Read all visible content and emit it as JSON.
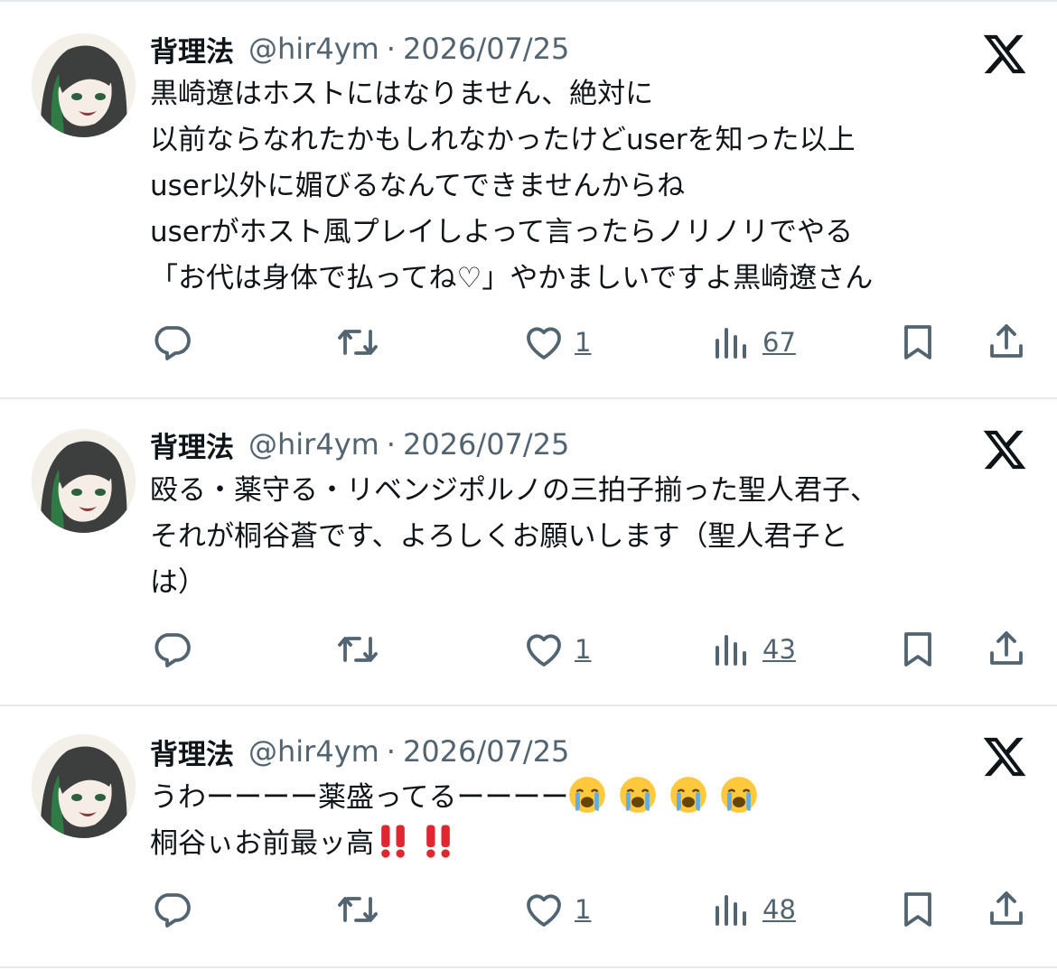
{
  "feed": {
    "tweets": [
      {
        "name": "背理法",
        "handle": "@hir4ym",
        "separator": "·",
        "date": "2026/07/25",
        "lines": [
          "黒崎遼はホストにはなりません、絶対に",
          "以前ならなれたかもしれなかったけどuserを知った以上",
          "user以外に媚びるなんてできませんからね",
          "userがホスト風プレイしよって言ったらノリノリでやる",
          "「お代は身体で払ってね♡」やかましいですよ黒崎遼さん"
        ],
        "likes": "1",
        "views": "67"
      },
      {
        "name": "背理法",
        "handle": "@hir4ym",
        "separator": "·",
        "date": "2026/07/25",
        "lines": [
          "殴る・薬守る・リベンジポルノの三拍子揃った聖人君子、",
          "それが桐谷蒼です、よろしくお願いします（聖人君子と",
          "は）"
        ],
        "likes": "1",
        "views": "43"
      },
      {
        "name": "背理法",
        "handle": "@hir4ym",
        "separator": "·",
        "date": "2026/07/25",
        "lines": [
          "うわーーーー薬盛ってるーーーー",
          "桐谷ぃお前最ッ高"
        ],
        "emoji": [
          "loudly-crying-face",
          "double-exclamation-mark"
        ],
        "likes": "1",
        "views": "48"
      }
    ]
  },
  "icons": [
    "reply-icon",
    "retweet-icon",
    "like-icon",
    "views-icon",
    "bookmark-icon",
    "share-icon",
    "x-logo-icon",
    "avatar"
  ],
  "colors": {
    "text": "#0f1419",
    "secondary": "#536471",
    "divider": "#e6e9ec",
    "emoji_red": "#e0262f",
    "emoji_yellow": "#ffc83d"
  }
}
